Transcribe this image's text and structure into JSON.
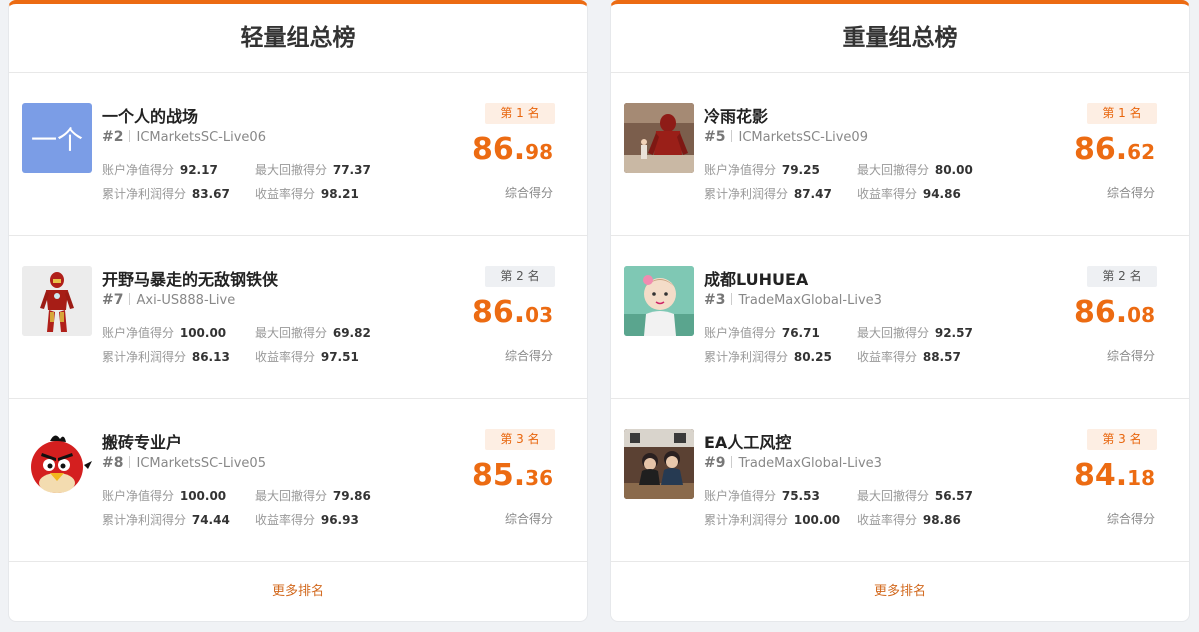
{
  "accent_color": "#ec6b12",
  "panels": [
    {
      "title": "轻量组总榜",
      "more_label": "更多排名",
      "entries": [
        {
          "name": "一个人的战场",
          "rank_no": "#2",
          "account": "ICMarketsSC-Live06",
          "badge": "第 1 名",
          "m1_label": "账户净值得分",
          "m1_val": "92.17",
          "m2_label": "最大回撤得分",
          "m2_val": "77.37",
          "m3_label": "累计净利润得分",
          "m3_val": "83.67",
          "m4_label": "收益率得分",
          "m4_val": "98.21",
          "score_int": "86.",
          "score_dec": "98",
          "score_label": "综合得分",
          "avatar": "text-avatar-icon",
          "avatar_text": "一个"
        },
        {
          "name": "开野马暴走的无敌钢铁侠",
          "rank_no": "#7",
          "account": "Axi-US888-Live",
          "badge": "第 2 名",
          "m1_label": "账户净值得分",
          "m1_val": "100.00",
          "m2_label": "最大回撤得分",
          "m2_val": "69.82",
          "m3_label": "累计净利润得分",
          "m3_val": "86.13",
          "m4_label": "收益率得分",
          "m4_val": "97.51",
          "score_int": "86.",
          "score_dec": "03",
          "score_label": "综合得分",
          "avatar": "iron-man-avatar-icon"
        },
        {
          "name": "搬砖专业户",
          "rank_no": "#8",
          "account": "ICMarketsSC-Live05",
          "badge": "第 3 名",
          "m1_label": "账户净值得分",
          "m1_val": "100.00",
          "m2_label": "最大回撤得分",
          "m2_val": "79.86",
          "m3_label": "累计净利润得分",
          "m3_val": "74.44",
          "m4_label": "收益率得分",
          "m4_val": "96.93",
          "score_int": "85.",
          "score_dec": "36",
          "score_label": "综合得分",
          "avatar": "angry-bird-avatar-icon"
        }
      ]
    },
    {
      "title": "重量组总榜",
      "more_label": "更多排名",
      "entries": [
        {
          "name": "冷雨花影",
          "rank_no": "#5",
          "account": "ICMarketsSC-Live09",
          "badge": "第 1 名",
          "m1_label": "账户净值得分",
          "m1_val": "79.25",
          "m2_label": "最大回撤得分",
          "m2_val": "80.00",
          "m3_label": "累计净利润得分",
          "m3_val": "87.47",
          "m4_label": "收益率得分",
          "m4_val": "94.86",
          "score_int": "86.",
          "score_dec": "62",
          "score_label": "综合得分",
          "avatar": "robot-statue-photo-icon"
        },
        {
          "name": "成都LUHUEA",
          "rank_no": "#3",
          "account": "TradeMaxGlobal-Live3",
          "badge": "第 2 名",
          "m1_label": "账户净值得分",
          "m1_val": "76.71",
          "m2_label": "最大回撤得分",
          "m2_val": "92.57",
          "m3_label": "累计净利润得分",
          "m3_val": "80.25",
          "m4_label": "收益率得分",
          "m4_val": "88.57",
          "score_int": "86.",
          "score_dec": "08",
          "score_label": "综合得分",
          "avatar": "baby-photo-icon"
        },
        {
          "name": "EA人工风控",
          "rank_no": "#9",
          "account": "TradeMaxGlobal-Live3",
          "badge": "第 3 名",
          "m1_label": "账户净值得分",
          "m1_val": "75.53",
          "m2_label": "最大回撤得分",
          "m2_val": "56.57",
          "m3_label": "累计净利润得分",
          "m3_val": "100.00",
          "m4_label": "收益率得分",
          "m4_val": "98.86",
          "score_int": "84.",
          "score_dec": "18",
          "score_label": "综合得分",
          "avatar": "kids-photo-icon"
        }
      ]
    }
  ]
}
